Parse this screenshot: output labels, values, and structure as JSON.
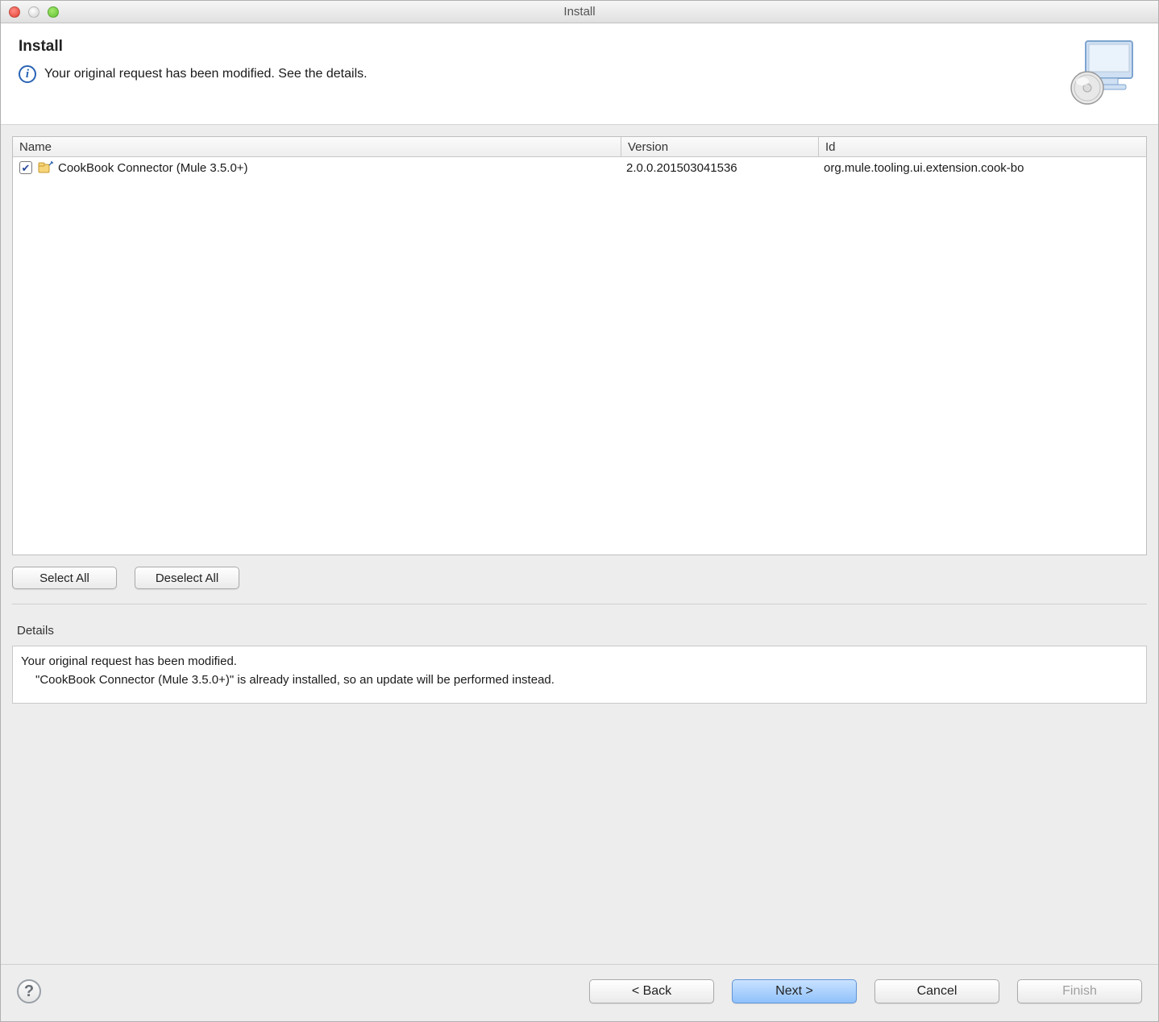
{
  "window": {
    "title": "Install"
  },
  "header": {
    "title": "Install",
    "message": "Your original request has been modified.  See the details."
  },
  "table": {
    "columns": {
      "name": "Name",
      "version": "Version",
      "id": "Id"
    },
    "rows": [
      {
        "checked": true,
        "name": "CookBook Connector (Mule 3.5.0+)",
        "version": "2.0.0.201503041536",
        "id": "org.mule.tooling.ui.extension.cook-bo"
      }
    ]
  },
  "buttons": {
    "select_all": "Select All",
    "deselect_all": "Deselect All",
    "back": "< Back",
    "next": "Next >",
    "cancel": "Cancel",
    "finish": "Finish"
  },
  "details": {
    "label": "Details",
    "line1": "Your original request has been modified.",
    "line2": "\"CookBook Connector (Mule 3.5.0+)\" is already installed, so an update will be performed instead."
  }
}
